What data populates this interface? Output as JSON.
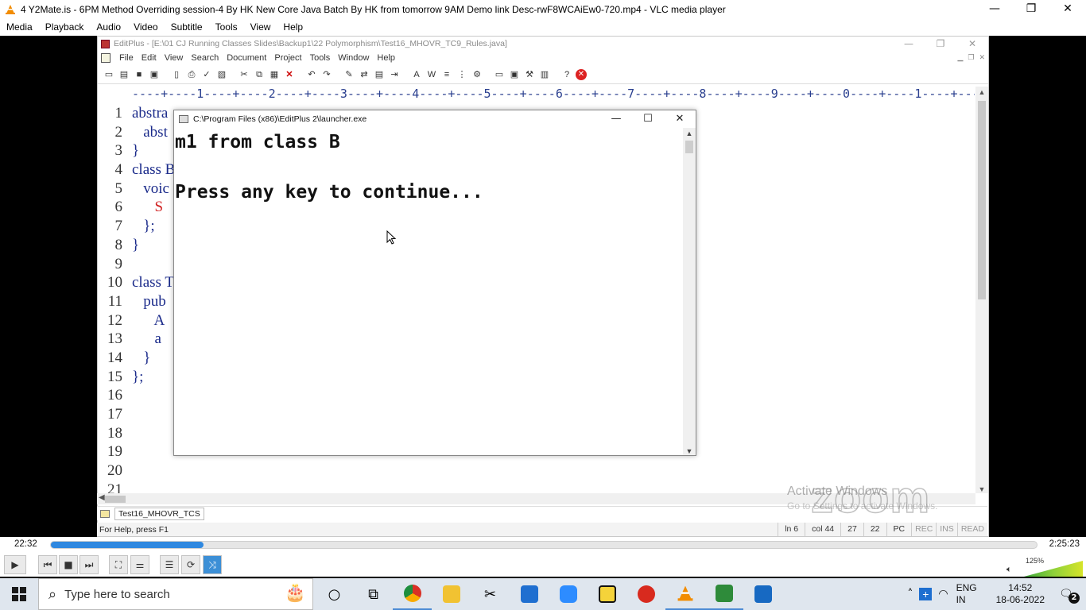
{
  "vlc": {
    "title": "4 Y2Mate.is - 6PM Method Overriding session-4 By HK New Core Java Batch By HK from tomorrow 9AM  Demo link Desc-rwF8WCAiEw0-720.mp4 - VLC media player",
    "menu": [
      "Media",
      "Playback",
      "Audio",
      "Video",
      "Subtitle",
      "Tools",
      "View",
      "Help"
    ],
    "time_elapsed": "22:32",
    "time_total": "2:25:23",
    "progress_fraction": 0.155,
    "volume_percent": "125%",
    "window_buttons": [
      "—",
      "❐",
      "✕"
    ]
  },
  "editplus": {
    "title": "EditPlus - [E:\\01 CJ Running Classes Slides\\Backup1\\22 Polymorphism\\Test16_MHOVR_TC9_Rules.java]",
    "menu": [
      "File",
      "Edit",
      "View",
      "Search",
      "Document",
      "Project",
      "Tools",
      "Window",
      "Help"
    ],
    "ruler": "----+----1----+----2----+----3----+----4----+----5----+----6----+----7----+----8----+----9----+----0----+----1----+----2-",
    "line_numbers": [
      "1",
      "2",
      "3",
      "4",
      "5",
      "6",
      "7",
      "8",
      "9",
      "10",
      "11",
      "12",
      "13",
      "14",
      "15",
      "16",
      "17",
      "18",
      "19",
      "20",
      "21"
    ],
    "code_lines": [
      "abstra",
      "   abst",
      "}",
      "class B",
      "   voic",
      "      S",
      "   };",
      "}",
      "",
      "class T",
      "   pub",
      "      A",
      "      a",
      "   }",
      "};",
      "",
      "",
      "",
      "",
      "",
      ""
    ],
    "tab_name": "Test16_MHOVR_TCS",
    "status_help": "For Help, press F1",
    "status_line": "ln 6",
    "status_col": "col 44",
    "status_n1": "27",
    "status_n2": "22",
    "status_mode": "PC",
    "status_rec": "REC",
    "status_ins": "INS",
    "status_read": "READ"
  },
  "console": {
    "title": "C:\\Program Files (x86)\\EditPlus 2\\launcher.exe",
    "line1": "m1 from class B",
    "line2": "Press any key to continue..."
  },
  "watermark": {
    "zoom": "zoom",
    "activate_title": "Activate Windows",
    "activate_sub": "Go to Settings to activate Windows."
  },
  "taskbar": {
    "search_placeholder": "Type here to search",
    "lang_top": "ENG",
    "lang_bottom": "IN",
    "time": "14:52",
    "date": "18-06-2022",
    "notification_count": "2"
  }
}
